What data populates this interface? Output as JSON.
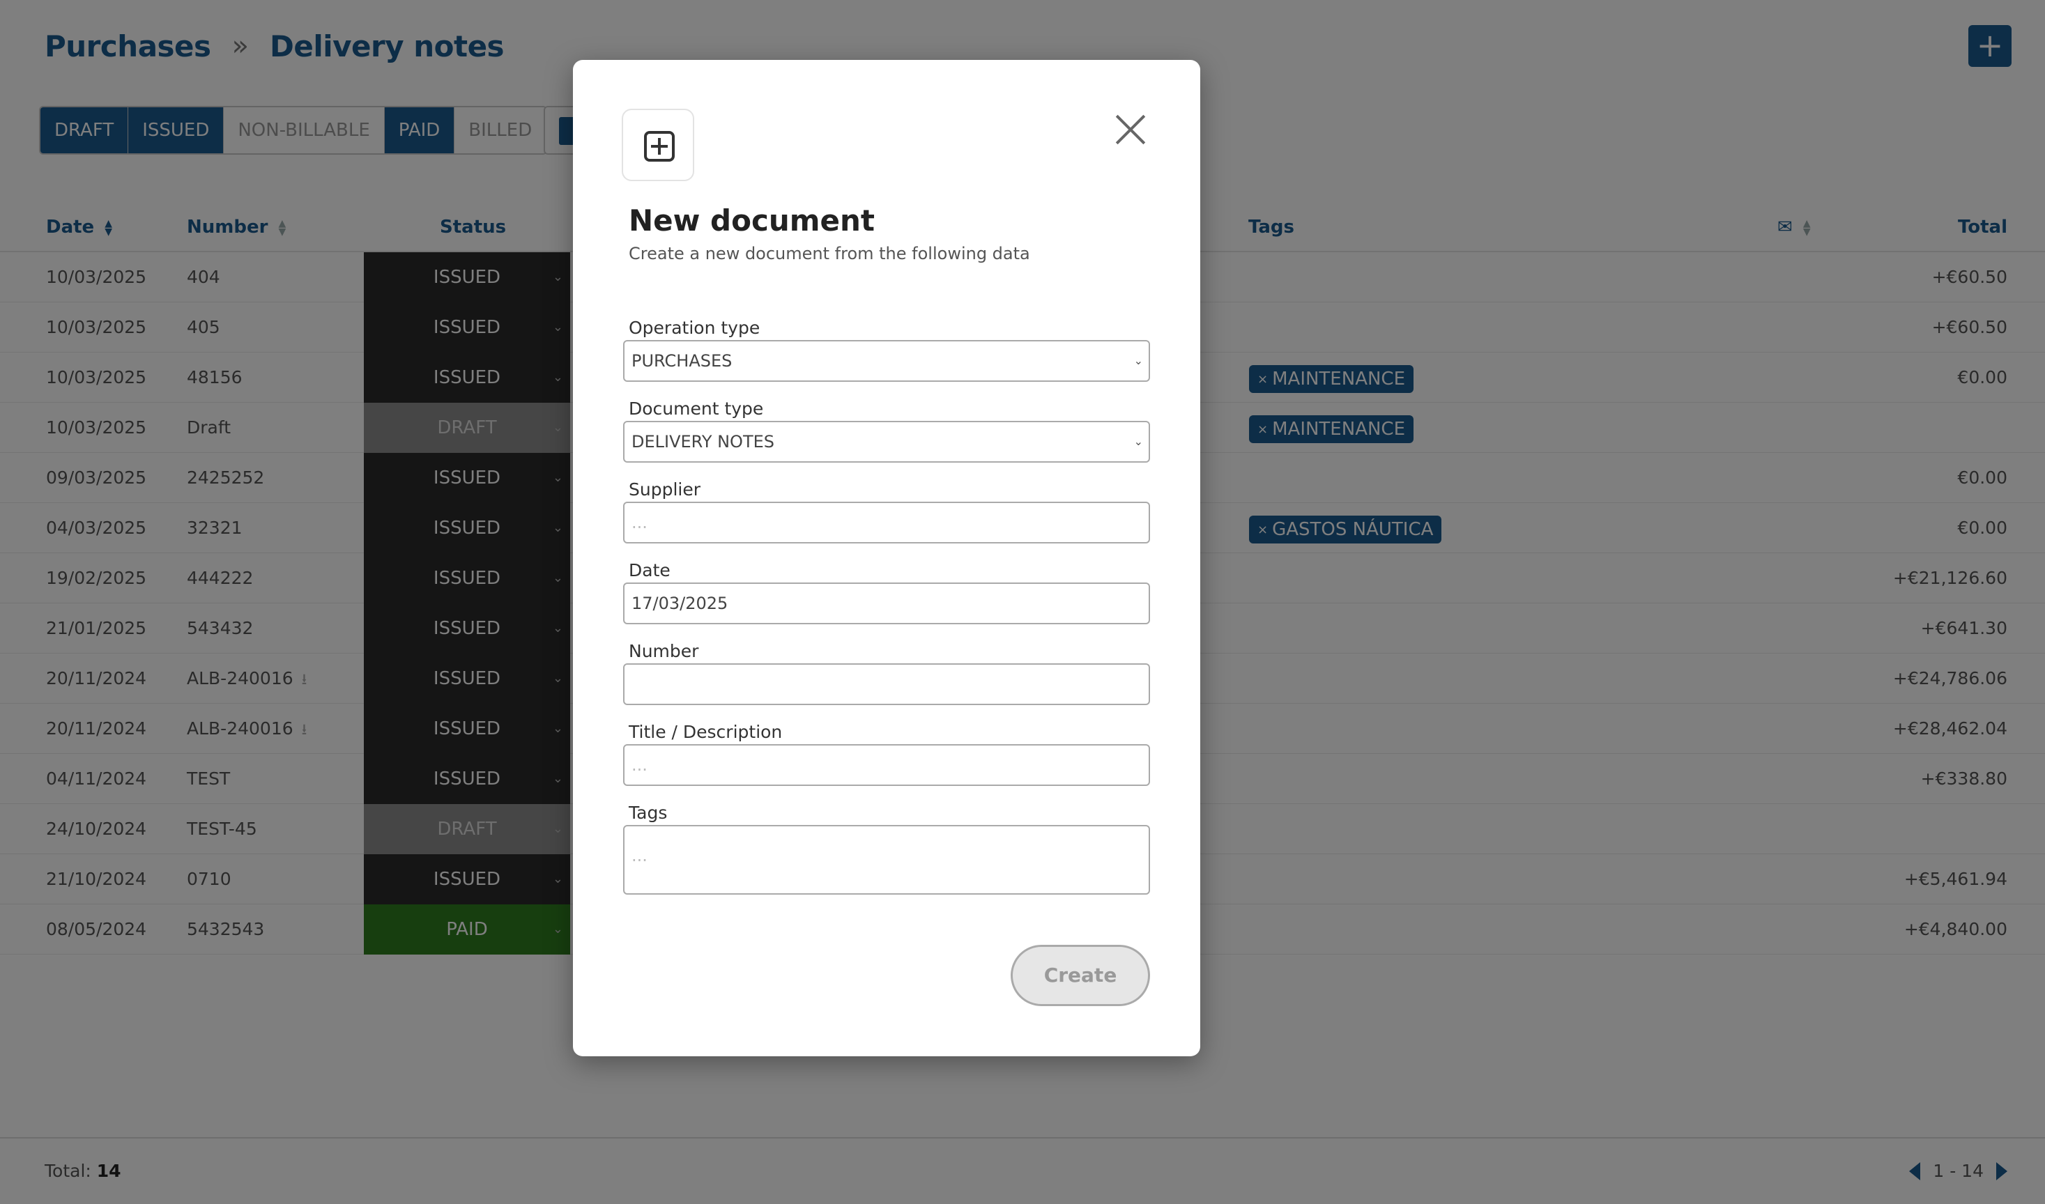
{
  "header": {
    "crumbs": [
      "Purchases",
      "Delivery notes"
    ],
    "crumb_separator": "»",
    "add_label": "+"
  },
  "filters": [
    "DRAFT",
    "ISSUED",
    "NON-BILLABLE",
    "PAID",
    "BILLED"
  ],
  "filters_active": [
    "DRAFT",
    "ISSUED",
    "PAID"
  ],
  "table": {
    "columns": {
      "date": "Date",
      "number": "Number",
      "status": "Status",
      "tags": "Tags",
      "total": "Total"
    },
    "rows": [
      {
        "date": "10/03/2025",
        "number": "404",
        "status": "ISSUED",
        "tag": "",
        "total": "+€60.50"
      },
      {
        "date": "10/03/2025",
        "number": "405",
        "status": "ISSUED",
        "tag": "",
        "total": "+€60.50"
      },
      {
        "date": "10/03/2025",
        "number": "48156",
        "status": "ISSUED",
        "tag": "MAINTENANCE",
        "total": "€0.00"
      },
      {
        "date": "10/03/2025",
        "number": "Draft",
        "status": "DRAFT",
        "tag": "MAINTENANCE",
        "total": ""
      },
      {
        "date": "09/03/2025",
        "number": "2425252",
        "status": "ISSUED",
        "tag": "",
        "total": "€0.00"
      },
      {
        "date": "04/03/2025",
        "number": "32321",
        "status": "ISSUED",
        "tag": "GASTOS NÁUTICA",
        "total": "€0.00"
      },
      {
        "date": "19/02/2025",
        "number": "444222",
        "status": "ISSUED",
        "tag": "",
        "total": "+€21,126.60"
      },
      {
        "date": "21/01/2025",
        "number": "543432",
        "status": "ISSUED",
        "tag": "",
        "total": "+€641.30"
      },
      {
        "date": "20/11/2024",
        "number": "ALB-240016",
        "status": "ISSUED",
        "tag": "",
        "total": "+€24,786.06",
        "download": true
      },
      {
        "date": "20/11/2024",
        "number": "ALB-240016",
        "status": "ISSUED",
        "tag": "",
        "total": "+€28,462.04",
        "download": true
      },
      {
        "date": "04/11/2024",
        "number": "TEST",
        "status": "ISSUED",
        "tag": "",
        "total": "+€338.80"
      },
      {
        "date": "24/10/2024",
        "number": "TEST-45",
        "status": "DRAFT",
        "tag": "",
        "total": ""
      },
      {
        "date": "21/10/2024",
        "number": "0710",
        "status": "ISSUED",
        "tag": "",
        "total": "+€5,461.94"
      },
      {
        "date": "08/05/2024",
        "number": "5432543",
        "status": "PAID",
        "tag": "",
        "total": "+€4,840.00"
      }
    ]
  },
  "footer": {
    "total_label": "Total:",
    "total_count": "14",
    "page_range": "1 - 14"
  },
  "modal": {
    "title": "New document",
    "subtitle": "Create a new document from the following data",
    "fields": {
      "operation_type": {
        "label": "Operation type",
        "value": "PURCHASES"
      },
      "document_type": {
        "label": "Document type",
        "value": "DELIVERY NOTES"
      },
      "supplier": {
        "label": "Supplier",
        "placeholder": "..."
      },
      "date": {
        "label": "Date",
        "value": "17/03/2025"
      },
      "number": {
        "label": "Number",
        "value": ""
      },
      "title": {
        "label": "Title / Description",
        "placeholder": "..."
      },
      "tags": {
        "label": "Tags",
        "placeholder": "..."
      }
    },
    "create_label": "Create"
  },
  "colors": {
    "brand": "#1a5b8f",
    "issued": "#2b2b2b",
    "draft": "#8c8c8c",
    "paid": "#2e7d1e"
  }
}
